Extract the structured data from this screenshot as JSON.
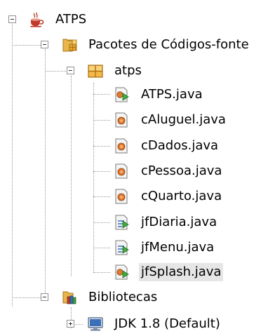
{
  "tree": {
    "project": {
      "label": "ATPS",
      "icon": "java-project-icon"
    },
    "source_packages": {
      "label": "Pacotes de Códigos-fonte",
      "icon": "source-packages-icon"
    },
    "package": {
      "label": "atps",
      "icon": "package-icon"
    },
    "files": [
      {
        "label": "ATPS.java",
        "icon": "java-main-class-icon"
      },
      {
        "label": "cAluguel.java",
        "icon": "java-class-icon"
      },
      {
        "label": "cDados.java",
        "icon": "java-class-icon"
      },
      {
        "label": "cPessoa.java",
        "icon": "java-class-icon"
      },
      {
        "label": "cQuarto.java",
        "icon": "java-class-icon"
      },
      {
        "label": "jfDiaria.java",
        "icon": "java-form-icon"
      },
      {
        "label": "jfMenu.java",
        "icon": "java-form-icon"
      },
      {
        "label": "jfSplash.java",
        "icon": "java-main-class-icon",
        "selected": true
      }
    ],
    "libraries": {
      "label": "Bibliotecas",
      "icon": "libraries-icon"
    },
    "jdk": {
      "label": "JDK 1.8 (Default)",
      "icon": "jdk-monitor-icon"
    }
  },
  "colors": {
    "selection": "#e6e6e6",
    "folder": "#e8b64a",
    "package": "#e5a52e",
    "class_orange": "#e07a2f",
    "run_green": "#3fae3f"
  }
}
